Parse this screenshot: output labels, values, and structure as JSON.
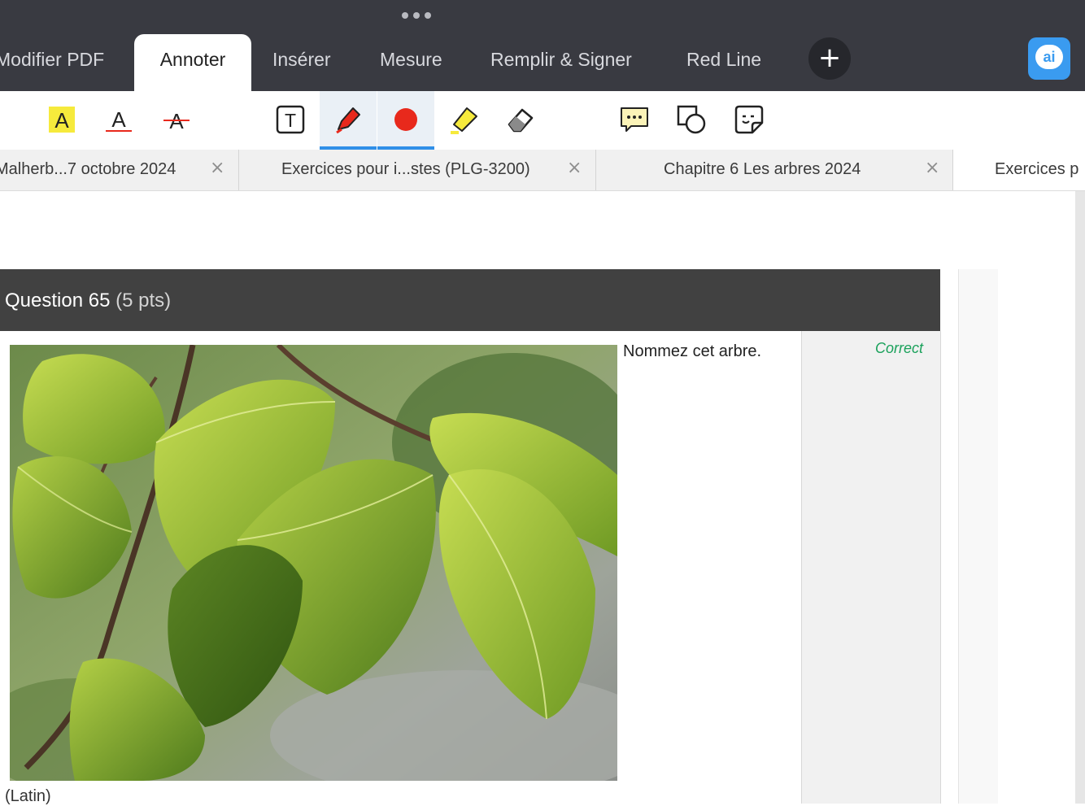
{
  "ribbon": {
    "tabs": [
      {
        "label": "Modifier PDF"
      },
      {
        "label": "Annoter"
      },
      {
        "label": "Insérer"
      },
      {
        "label": "Mesure"
      },
      {
        "label": "Remplir & Signer"
      },
      {
        "label": "Red Line"
      }
    ],
    "active_tab": "Annoter",
    "add_symbol": "+",
    "ai_label": "ai"
  },
  "tools": [
    {
      "name": "text-highlight",
      "glyph": "A"
    },
    {
      "name": "text-underline",
      "glyph": "A"
    },
    {
      "name": "text-strikethrough",
      "glyph": "A"
    },
    {
      "name": "text-box",
      "glyph": "T"
    },
    {
      "name": "pen"
    },
    {
      "name": "color-red"
    },
    {
      "name": "highlighter"
    },
    {
      "name": "eraser"
    },
    {
      "name": "comment"
    },
    {
      "name": "shapes"
    },
    {
      "name": "sticker"
    }
  ],
  "document_tabs": [
    {
      "label": "Malherb...7 octobre 2024"
    },
    {
      "label": "Exercices pour i...stes (PLG-3200)"
    },
    {
      "label": "Chapitre 6 Les arbres  2024"
    },
    {
      "label": "Exercices p"
    }
  ],
  "close_symbol": "×",
  "question": {
    "title": "Question 65",
    "points": "(5 pts)",
    "prompt": "Nommez cet arbre.",
    "status": "Correct",
    "answer_hint": "(Latin)"
  },
  "colors": {
    "topbar": "#393a41",
    "accent": "#2f8fe8",
    "question_header": "#414141",
    "correct": "#1aa15b",
    "pen_red": "#e8291c",
    "highlight_yellow": "#f6ea3c"
  }
}
